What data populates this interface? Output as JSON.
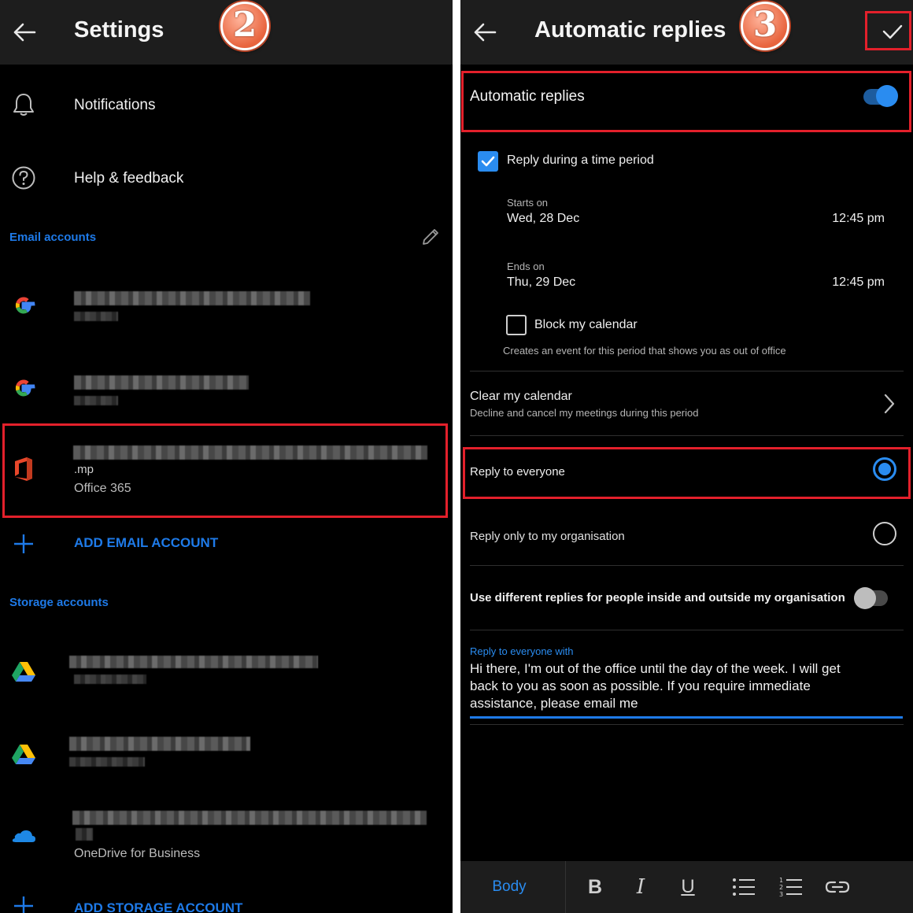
{
  "left": {
    "header_title": "Settings",
    "step_badge": "2",
    "notifications_label": "Notifications",
    "help_label": "Help & feedback",
    "email_section_title": "Email accounts",
    "email_accounts": [
      {
        "icon": "google-icon",
        "subtitle": ""
      },
      {
        "icon": "google-icon",
        "subtitle": ""
      },
      {
        "icon": "office-icon",
        "name_suffix": ".mp",
        "subtitle": "Office 365"
      }
    ],
    "add_email_label": "ADD EMAIL ACCOUNT",
    "storage_section_title": "Storage accounts",
    "storage_accounts": [
      {
        "icon": "google-drive-icon",
        "subtitle": ""
      },
      {
        "icon": "google-drive-icon",
        "subtitle": ""
      },
      {
        "icon": "onedrive-icon",
        "subtitle": "OneDrive for Business"
      }
    ],
    "add_storage_label": "ADD STORAGE ACCOUNT"
  },
  "right": {
    "header_title": "Automatic replies",
    "step_badge": "3",
    "auto_replies_label": "Automatic replies",
    "auto_replies_on": true,
    "reply_period_label": "Reply during a time period",
    "reply_period_checked": true,
    "starts_label": "Starts on",
    "starts_date": "Wed, 28 Dec",
    "starts_time": "12:45 pm",
    "ends_label": "Ends on",
    "ends_date": "Thu, 29 Dec",
    "ends_time": "12:45 pm",
    "block_calendar_label": "Block my calendar",
    "block_calendar_checked": false,
    "block_calendar_desc": "Creates an event for this period that shows you as out of office",
    "clear_calendar_title": "Clear my calendar",
    "clear_calendar_desc": "Decline and cancel my meetings during this period",
    "reply_everyone_label": "Reply to everyone",
    "reply_everyone_selected": true,
    "reply_org_label": "Reply only to my organisation",
    "reply_org_selected": false,
    "different_replies_label": "Use different replies for people inside and outside my organisation",
    "different_replies_on": false,
    "reply_with_label": "Reply to everyone with",
    "reply_message_line1": "Hi there, I'm out of the office until the day of the week.  I will get",
    "reply_message_line2": "back to you as soon as possible. If you require immediate",
    "reply_message_line3": "assistance, please email me",
    "toolbar": {
      "body_label": "Body",
      "bold_label": "B",
      "italic_label": "I",
      "underline_label": "U"
    }
  },
  "colors": {
    "accent_blue": "#2a8cf0",
    "link_blue": "#1e7ae8",
    "highlight_red": "#e3202b",
    "header_bg": "#1d1d1d",
    "panel_bg": "#000000"
  }
}
